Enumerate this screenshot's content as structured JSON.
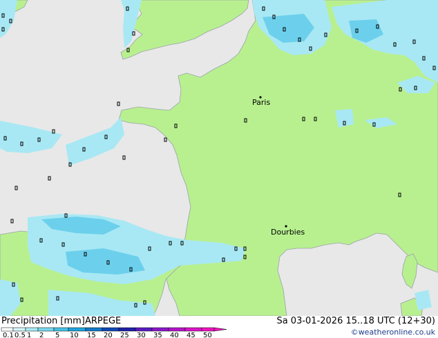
{
  "legend": {
    "title": "Precipitation [mm]",
    "model": "ARPEGE",
    "ticks": [
      "0.1",
      "0.5",
      "1",
      "2",
      "5",
      "10",
      "15",
      "20",
      "25",
      "30",
      "35",
      "40",
      "45",
      "50"
    ],
    "colors": [
      "#ffffff",
      "#d4f4f8",
      "#a8eaf2",
      "#78d8ec",
      "#48c2e4",
      "#1ea4dc",
      "#1478c8",
      "#1048b4",
      "#2020a8",
      "#5a1cc0",
      "#8a18c8",
      "#b414c8",
      "#dc14c8",
      "#f014c0"
    ]
  },
  "valid_time": "Sa 03-01-2026 15..18 UTC (12+30)",
  "credit": "©weatheronline.co.uk",
  "cities": [
    {
      "name": "Paris"
    },
    {
      "name": "Dourbies"
    }
  ],
  "colors": {
    "sea": "#e8e8e8",
    "land": "#b8f090",
    "coast": "#9aa0a6",
    "precip_light": "#a8e8f4",
    "precip_medium": "#6cd0ec"
  }
}
